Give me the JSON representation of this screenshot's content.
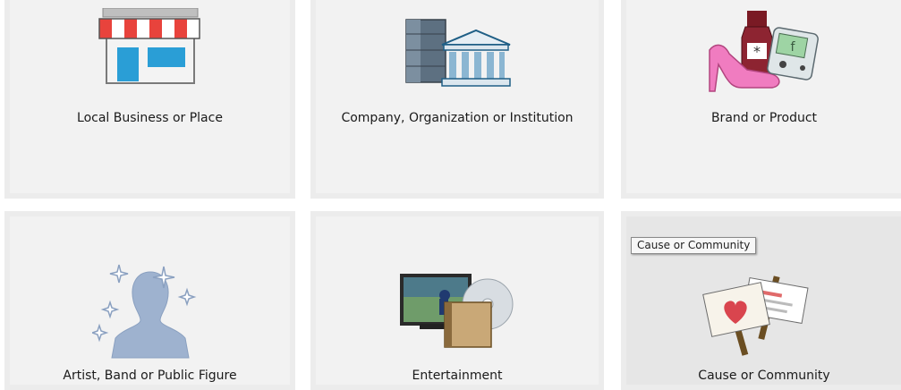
{
  "categories": [
    {
      "label": "Local Business or Place",
      "icon": "storefront-icon"
    },
    {
      "label": "Company, Organization or Institution",
      "icon": "institution-buildings-icon"
    },
    {
      "label": "Brand or Product",
      "icon": "products-icon"
    },
    {
      "label": "Artist, Band or Public Figure",
      "icon": "public-figure-silhouette-icon"
    },
    {
      "label": "Entertainment",
      "icon": "entertainment-tv-disc-icon"
    },
    {
      "label": "Cause or Community",
      "icon": "protest-signs-icon"
    }
  ],
  "tooltip": {
    "text": "Cause or Community"
  },
  "colors": {
    "tile_border": "#ececec",
    "tile_fill": "#f2f2f2",
    "tile_hover_fill": "#e6e6e6",
    "heart": "#d9454e"
  }
}
